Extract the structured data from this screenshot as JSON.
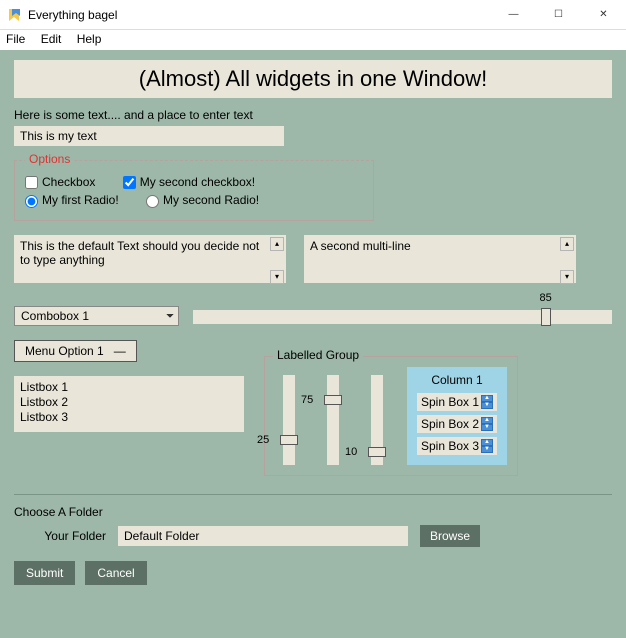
{
  "window": {
    "title": "Everything bagel",
    "controls": {
      "min": "—",
      "max": "☐",
      "close": "✕"
    }
  },
  "menu": {
    "file": "File",
    "edit": "Edit",
    "help": "Help"
  },
  "headline": "(Almost) All widgets in one Window!",
  "intro_label": "Here is some text.... and a place to enter text",
  "text_input_value": "This is my text",
  "options": {
    "legend": "Options",
    "cb1_label": "Checkbox",
    "cb1_checked": false,
    "cb2_label": "My second checkbox!",
    "cb2_checked": true,
    "r1_label": "My first Radio!",
    "r2_label": "My second Radio!",
    "radio_selected": "r1"
  },
  "ml1": "This is the default Text should you decide not to type anything",
  "ml2": "A second multi-line",
  "combo": {
    "selected": "Combobox 1"
  },
  "hslider": {
    "value": 85,
    "min": 0,
    "max": 100
  },
  "menu_button": "Menu Option 1",
  "listbox": [
    "Listbox 1",
    "Listbox 2",
    "Listbox 3"
  ],
  "labelled_group": {
    "legend": "Labelled Group",
    "vsliders": [
      {
        "value": 25
      },
      {
        "value": 75
      },
      {
        "value": 10
      }
    ],
    "column_header": "Column 1",
    "spins": [
      "Spin Box 1",
      "Spin Box 2",
      "Spin Box 3"
    ]
  },
  "folder": {
    "section_label": "Choose A Folder",
    "field_label": "Your Folder",
    "value": "Default Folder",
    "browse": "Browse"
  },
  "buttons": {
    "submit": "Submit",
    "cancel": "Cancel"
  }
}
